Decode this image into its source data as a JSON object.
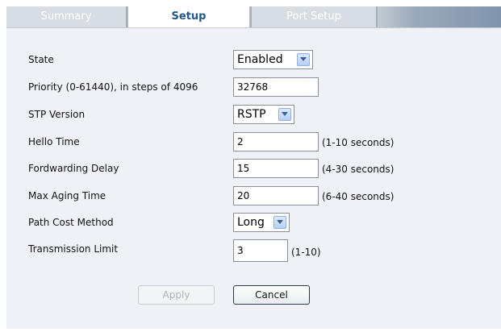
{
  "tabs": [
    {
      "label": "Summary",
      "active": false
    },
    {
      "label": "Setup",
      "active": true
    },
    {
      "label": "Port Setup",
      "active": false
    }
  ],
  "form": {
    "state": {
      "label": "State",
      "value": "Enabled"
    },
    "priority": {
      "label": "Priority (0-61440), in steps of 4096",
      "value": "32768"
    },
    "stp_version": {
      "label": "STP Version",
      "value": "RSTP"
    },
    "hello_time": {
      "label": "Hello Time",
      "value": "2",
      "hint": "(1-10 seconds)"
    },
    "forwarding_delay": {
      "label": "Fordwarding Delay",
      "value": "15",
      "hint": "(4-30 seconds)"
    },
    "max_aging_time": {
      "label": "Max Aging Time",
      "value": "20",
      "hint": "(6-40 seconds)"
    },
    "path_cost_method": {
      "label": "Path Cost Method",
      "value": "Long"
    },
    "transmission_limit": {
      "label": "Transmission Limit",
      "value": "3",
      "hint": "(1-10)"
    }
  },
  "buttons": {
    "apply": "Apply",
    "cancel": "Cancel"
  },
  "colors": {
    "active_tab_text": "#21578a",
    "panel_bg": "#eef1f5"
  }
}
